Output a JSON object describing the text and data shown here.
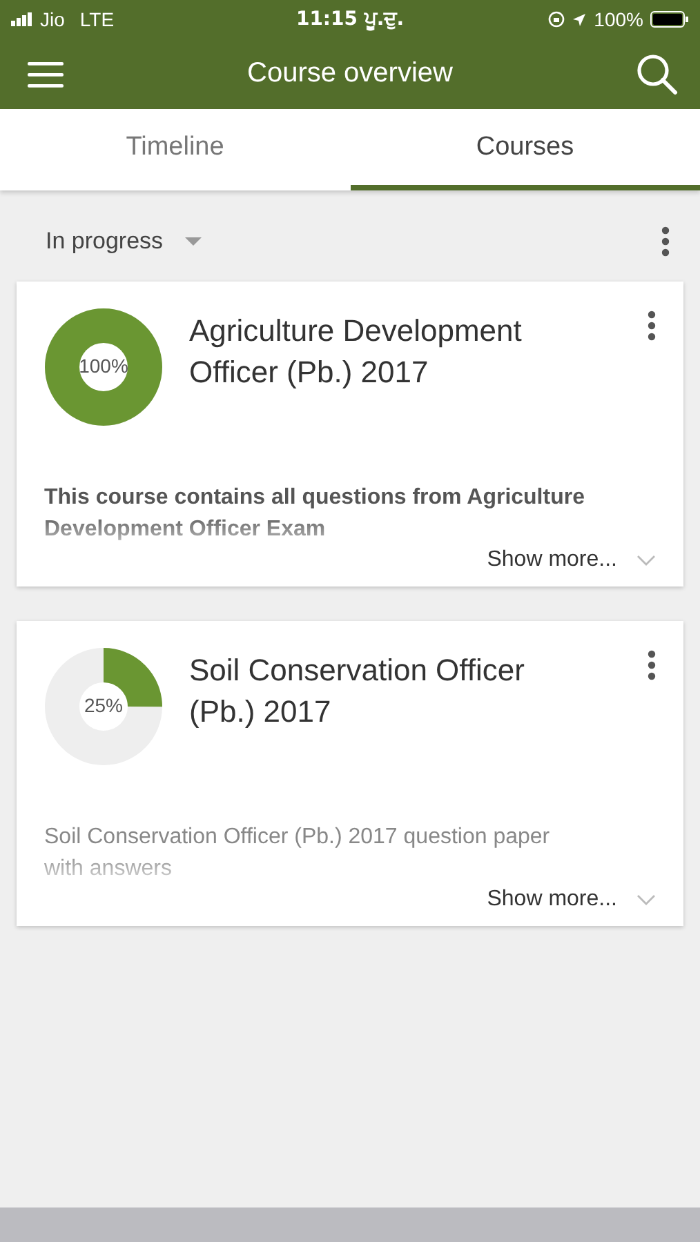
{
  "status_bar": {
    "carrier": "Jio",
    "network": "LTE",
    "time": "11:15 ਪੂ.ਦੁ.",
    "battery": "100%"
  },
  "app_bar": {
    "title": "Course overview"
  },
  "tabs": [
    {
      "label": "Timeline",
      "selected": false
    },
    {
      "label": "Courses",
      "selected": true
    }
  ],
  "filter": {
    "label": "In progress"
  },
  "courses": [
    {
      "title": "Agriculture Development Officer (Pb.) 2017",
      "level": 1,
      "progress": "100%",
      "description": "This course contains all questions from Agriculture Development Officer Exam",
      "bold": true,
      "show_more": "Show more..."
    },
    {
      "title": "Soil Conservation Officer (Pb.) 2017",
      "level": 0.25,
      "progress": "25%",
      "description": "Soil Conservation Officer (Pb.) 2017 question paper with answers",
      "bold": false,
      "show_more": "Show more..."
    }
  ]
}
